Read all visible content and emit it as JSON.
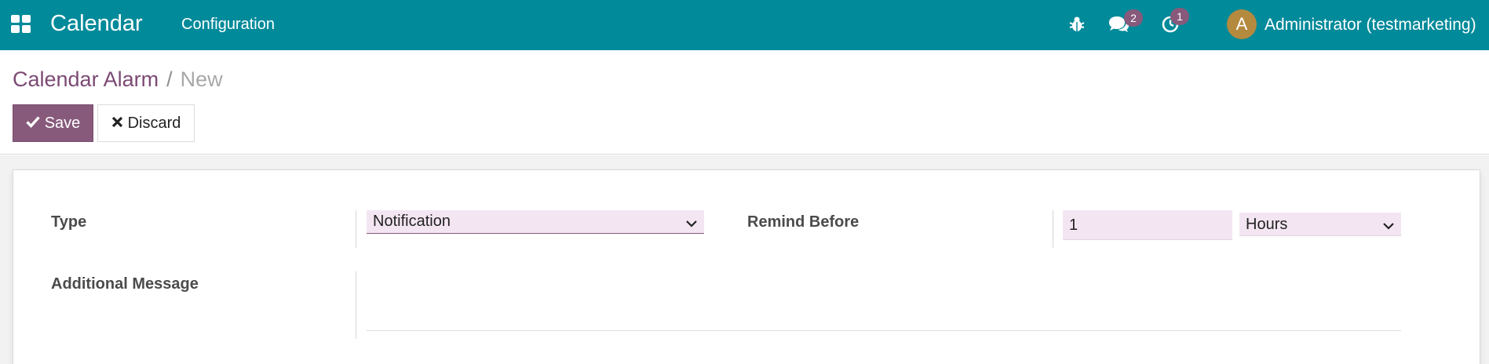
{
  "navbar": {
    "app_name": "Calendar",
    "menu_configuration": "Configuration",
    "chat_badge": "2",
    "activity_badge": "1",
    "avatar_initial": "A",
    "user_name": "Administrator (testmarketing)",
    "icons": [
      "apps-grid-icon",
      "bug-icon",
      "chat-bubbles-icon",
      "clock-icon"
    ],
    "color": "#018a9a"
  },
  "breadcrumb": {
    "parent": "Calendar Alarm",
    "separator": "/",
    "current": "New"
  },
  "toolbar": {
    "save_label": "Save",
    "discard_label": "Discard",
    "save_color": "#875a7b"
  },
  "form": {
    "type_label": "Type",
    "type_value": "Notification",
    "remind_label": "Remind Before",
    "remind_value": "1",
    "remind_unit": "Hours",
    "message_label": "Additional Message",
    "message_value": "",
    "field_bg_color": "#f3e6f2"
  }
}
